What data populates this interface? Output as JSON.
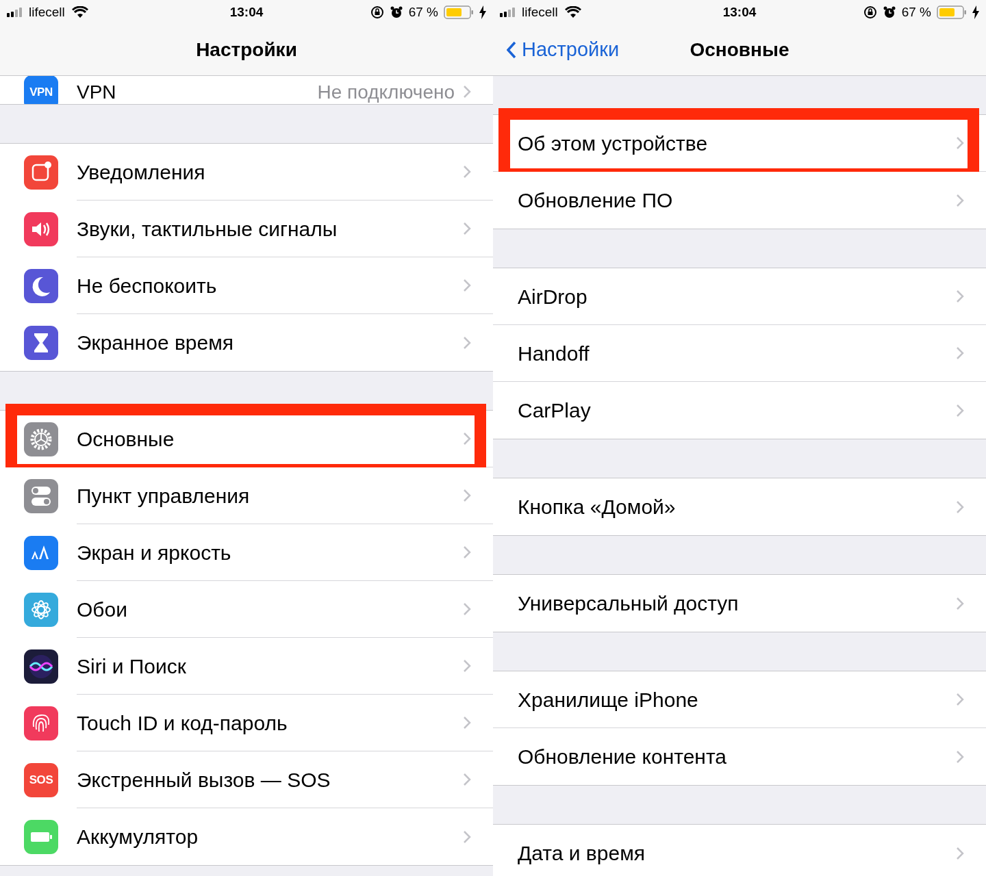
{
  "panels": [
    {
      "status_bar": {
        "carrier": "lifecell",
        "time": "13:04",
        "battery": "67 %"
      },
      "nav": {
        "title": "Настройки"
      },
      "top_row": {
        "kind": "vpn",
        "icon_text": "VPN",
        "label": "VPN",
        "value": "Не подключено"
      },
      "groups": [
        [
          {
            "kind": "notifications",
            "label": "Уведомления",
            "highlighted": false
          },
          {
            "kind": "sounds",
            "label": "Звуки, тактильные сигналы",
            "highlighted": false
          },
          {
            "kind": "moon",
            "label": "Не беспокоить",
            "highlighted": false
          },
          {
            "kind": "hourglass",
            "label": "Экранное время",
            "highlighted": false
          }
        ],
        [
          {
            "kind": "gear",
            "label": "Основные",
            "highlighted": true
          },
          {
            "kind": "toggles",
            "label": "Пункт управления",
            "highlighted": false
          },
          {
            "kind": "display",
            "label": "Экран и яркость",
            "highlighted": false
          },
          {
            "kind": "flower",
            "label": "Обои",
            "highlighted": false
          },
          {
            "kind": "siri",
            "label": "Siri и Поиск",
            "highlighted": false
          },
          {
            "kind": "fingerprint",
            "label": "Touch ID и код-пароль",
            "highlighted": false
          },
          {
            "kind": "sos",
            "icon_text": "SOS",
            "label": "Экстренный вызов — SOS",
            "highlighted": false
          },
          {
            "kind": "battery",
            "label": "Аккумулятор",
            "highlighted": false
          }
        ]
      ]
    },
    {
      "status_bar": {
        "carrier": "lifecell",
        "time": "13:04",
        "battery": "67 %"
      },
      "nav": {
        "back": "Настройки",
        "title": "Основные"
      },
      "groups": [
        [
          {
            "label": "Об этом устройстве",
            "highlighted": true
          },
          {
            "label": "Обновление ПО",
            "highlighted": false
          }
        ],
        [
          {
            "label": "AirDrop",
            "highlighted": false
          },
          {
            "label": "Handoff",
            "highlighted": false
          },
          {
            "label": "CarPlay",
            "highlighted": false
          }
        ],
        [
          {
            "label": "Кнопка «Домой»",
            "highlighted": false
          }
        ],
        [
          {
            "label": "Универсальный доступ",
            "highlighted": false
          }
        ],
        [
          {
            "label": "Хранилище iPhone",
            "highlighted": false
          },
          {
            "label": "Обновление контента",
            "highlighted": false
          }
        ],
        [
          {
            "label": "Дата и время",
            "highlighted": false
          }
        ]
      ]
    }
  ]
}
